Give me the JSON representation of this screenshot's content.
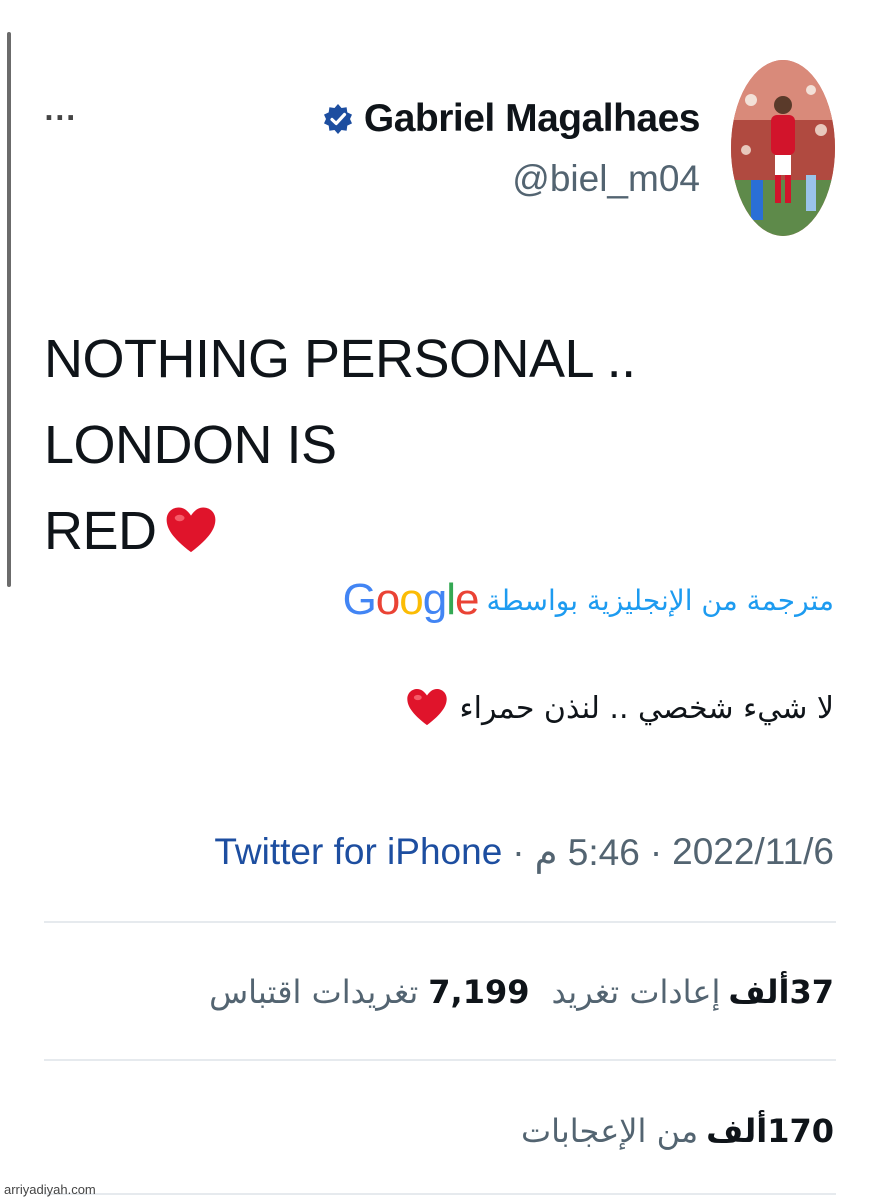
{
  "tweet": {
    "author": {
      "display_name": "Gabriel Magalhaes",
      "handle": "@biel_m04",
      "verified": true
    },
    "more_label": "...",
    "text_line1": "NOTHING PERSONAL .. LONDON IS",
    "text_line2": "RED",
    "translation": {
      "label": "مترجمة من الإنجليزية بواسطة",
      "provider": "Google",
      "text": "لا شيء شخصي .. لنذن حمراء"
    },
    "meta": {
      "source": "Twitter for iPhone",
      "separator": "·",
      "time": "5:46 م",
      "date": "2022/11/6"
    },
    "stats": {
      "retweets_value": "37",
      "retweets_unit": "ألف",
      "retweets_label": "إعادات تغريد",
      "quotes_value": "7,199",
      "quotes_label": "تغريدات اقتباس",
      "likes_value": "170",
      "likes_unit": "ألف",
      "likes_label": "من الإعجابات"
    }
  },
  "watermark": "arriyadiyah.com",
  "colors": {
    "link_blue": "#1d9bf0",
    "source_blue": "#1d4ea0",
    "muted": "#536471",
    "text": "#0f1419",
    "heart": "#e0142b",
    "verified": "#1d4ea0"
  },
  "icons": {
    "verified": "verified-badge-icon",
    "heart": "red-heart-emoji",
    "more": "more-options-icon"
  }
}
